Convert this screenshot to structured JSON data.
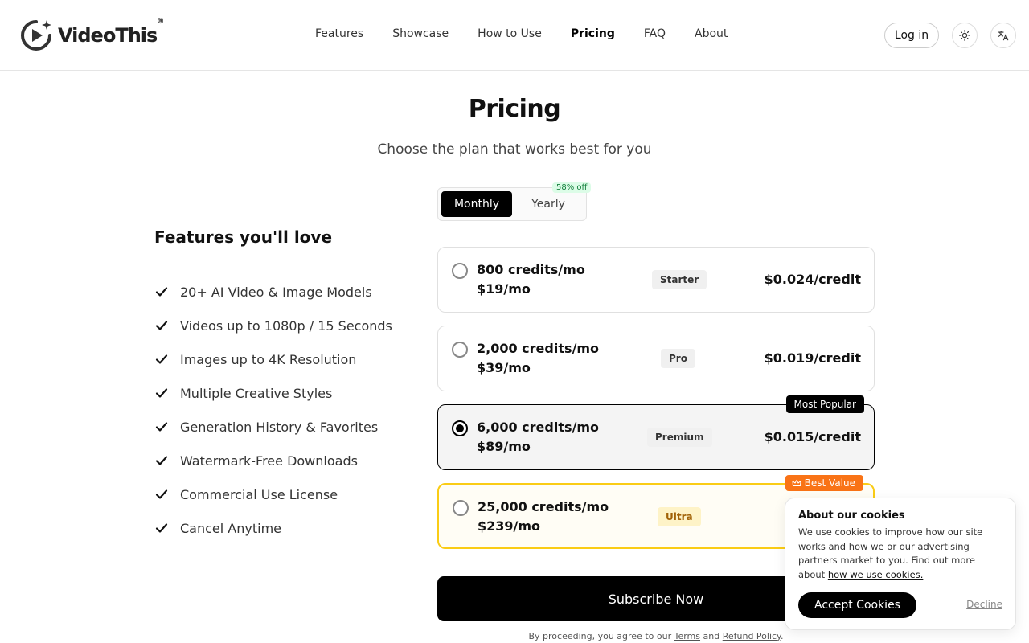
{
  "brand": {
    "name": "VideoThis",
    "registered_mark": "®"
  },
  "nav": {
    "items": [
      {
        "label": "Features",
        "active": false
      },
      {
        "label": "Showcase",
        "active": false
      },
      {
        "label": "How to Use",
        "active": false
      },
      {
        "label": "Pricing",
        "active": true
      },
      {
        "label": "FAQ",
        "active": false
      },
      {
        "label": "About",
        "active": false
      }
    ],
    "login_label": "Log in",
    "theme_icon": "sun-icon",
    "language_icon": "translate-icon"
  },
  "hero": {
    "title": "Pricing",
    "subtitle": "Choose the plan that works best for you"
  },
  "billing": {
    "monthly_label": "Monthly",
    "yearly_label": "Yearly",
    "discount": "58% off",
    "selected": "Monthly"
  },
  "features": {
    "title": "Features you'll love",
    "items": [
      "20+ AI Video & Image Models",
      "Videos up to 1080p / 15 Seconds",
      "Images up to 4K Resolution",
      "Multiple Creative Styles",
      "Generation History & Favorites",
      "Watermark-Free Downloads",
      "Commercial Use License",
      "Cancel Anytime"
    ]
  },
  "plans": [
    {
      "credits": "800 credits/mo",
      "price": "$19/mo",
      "tier": "Starter",
      "per_credit": "$0.024/credit",
      "selected": false
    },
    {
      "credits": "2,000 credits/mo",
      "price": "$39/mo",
      "tier": "Pro",
      "per_credit": "$0.019/credit",
      "selected": false
    },
    {
      "credits": "6,000 credits/mo",
      "price": "$89/mo",
      "tier": "Premium",
      "per_credit": "$0.015/credit",
      "selected": true,
      "flag": "Most Popular"
    },
    {
      "credits": "25,000 credits/mo",
      "price": "$239/mo",
      "tier": "Ultra",
      "per_credit": "$",
      "selected": false,
      "flag": "Best Value"
    }
  ],
  "subscribe_label": "Subscribe Now",
  "legal": {
    "prefix": "By proceeding, you agree to our",
    "terms": "Terms",
    "and": "and",
    "refund": "Refund Policy",
    "suffix": "."
  },
  "cookie": {
    "title": "About our cookies",
    "text": "We use cookies to improve how our site works and how we or our advertising partners market to you. Find out more about",
    "link": "how we use cookies.",
    "accept_label": "Accept Cookies",
    "decline_label": "Decline"
  },
  "colors": {
    "primary": "#000000",
    "best_value_flag": "#f97316",
    "best_value_border": "#facc15",
    "discount_badge_bg": "#dcfce7",
    "discount_badge_text": "#15803d"
  }
}
